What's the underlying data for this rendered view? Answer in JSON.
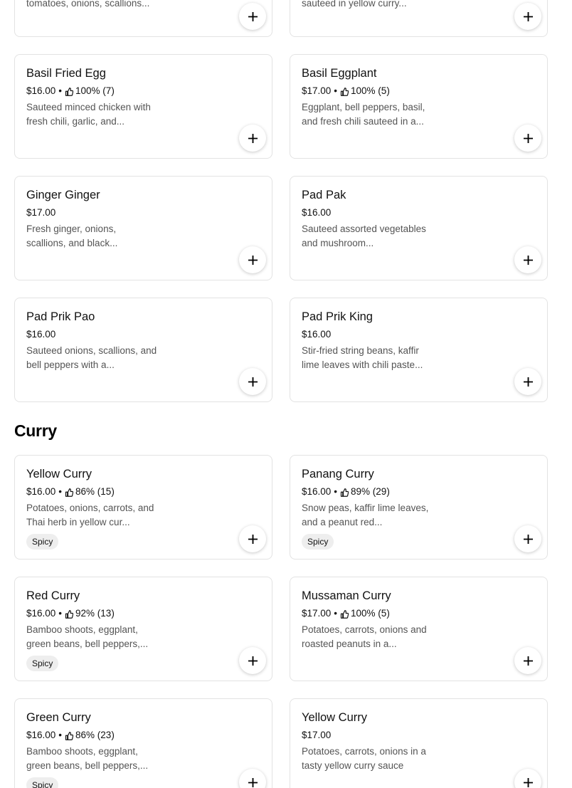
{
  "top_items": [
    {
      "name": "",
      "price": "",
      "rating": "",
      "desc": "tomatoes, onions, scallions..."
    },
    {
      "name": "",
      "price": "",
      "rating": "",
      "desc": "sauteed in yellow curry..."
    }
  ],
  "stir_fry_items": [
    {
      "name": "Basil Fried Egg",
      "price": "$16.00",
      "rating": "100% (7)",
      "desc": "Sauteed minced chicken with fresh chili, garlic, and..."
    },
    {
      "name": "Basil Eggplant",
      "price": "$17.00",
      "rating": "100% (5)",
      "desc": "Eggplant, bell peppers, basil, and fresh chili sauteed in a..."
    },
    {
      "name": "Ginger Ginger",
      "price": "$17.00",
      "rating": "",
      "desc": "Fresh ginger, onions, scallions, and black..."
    },
    {
      "name": "Pad Pak",
      "price": "$16.00",
      "rating": "",
      "desc": "Sauteed assorted vegetables and mushroom..."
    },
    {
      "name": "Pad Prik Pao",
      "price": "$16.00",
      "rating": "",
      "desc": "Sauteed onions, scallions, and bell peppers with a..."
    },
    {
      "name": "Pad Prik King",
      "price": "$16.00",
      "rating": "",
      "desc": "Stir-fried string beans, kaffir lime leaves with chili paste..."
    }
  ],
  "curry_section": {
    "title": "Curry",
    "items": [
      {
        "name": "Yellow Curry",
        "price": "$16.00",
        "rating": "86% (15)",
        "desc": "Potatoes, onions, carrots, and Thai herb in yellow cur...",
        "badge": "Spicy"
      },
      {
        "name": "Panang Curry",
        "price": "$16.00",
        "rating": "89% (29)",
        "desc": "Snow peas, kaffir lime leaves, and a peanut red...",
        "badge": "Spicy"
      },
      {
        "name": "Red Curry",
        "price": "$16.00",
        "rating": "92% (13)",
        "desc": "Bamboo shoots, eggplant, green beans, bell peppers,...",
        "badge": "Spicy"
      },
      {
        "name": "Mussaman Curry",
        "price": "$17.00",
        "rating": "100% (5)",
        "desc": "Potatoes, carrots, onions and roasted peanuts in a...",
        "badge": ""
      },
      {
        "name": "Green Curry",
        "price": "$16.00",
        "rating": "86% (23)",
        "desc": "Bamboo shoots, eggplant, green beans, bell peppers,...",
        "badge": "Spicy"
      },
      {
        "name": "Yellow Curry",
        "price": "$17.00",
        "rating": "",
        "desc": "Potatoes, carrots, onions in a tasty yellow curry sauce",
        "badge": ""
      }
    ]
  },
  "icons": {
    "add": "plus-icon",
    "rating": "thumbs-up-icon"
  }
}
